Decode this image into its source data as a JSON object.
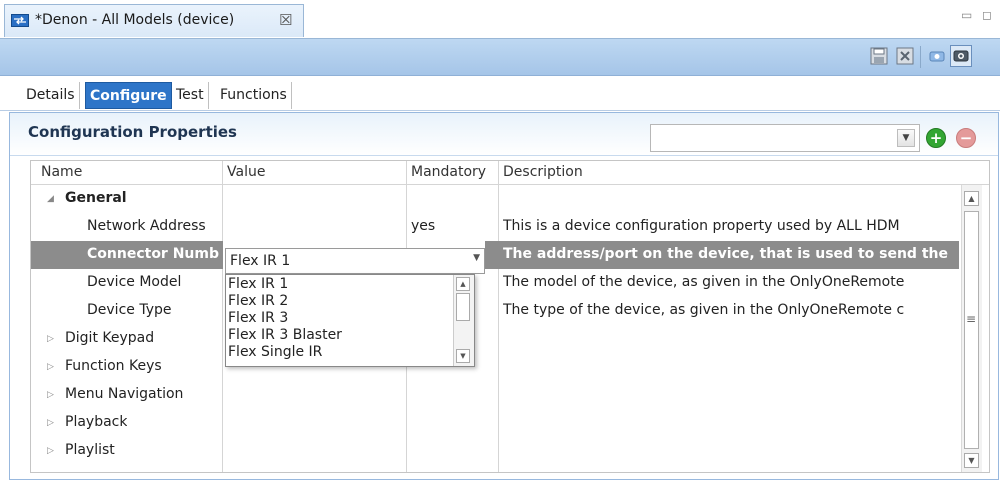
{
  "editor": {
    "tab_title": "*Denon - All Models (device)",
    "close_glyph": "☒",
    "minimize_glyph": "▭",
    "maximize_glyph": "◻"
  },
  "toolbar": {
    "icons": [
      "save-icon",
      "revert-icon",
      "device-settings-icon",
      "device-active-icon"
    ]
  },
  "subtabs": [
    "Details",
    "Configure",
    "Test",
    "Functions"
  ],
  "active_subtab": "Configure",
  "panel": {
    "title": "Configuration Properties",
    "filter_value": "",
    "add_icon": "add-icon",
    "remove_icon": "remove-icon"
  },
  "grid": {
    "columns": [
      "Name",
      "Value",
      "Mandatory",
      "Description"
    ],
    "groups": [
      {
        "name": "General",
        "expanded": true,
        "rows": [
          {
            "name": "Network Address",
            "value": "",
            "mandatory": "yes",
            "description": "This is a device configuration property used by ALL HDM"
          },
          {
            "name": "Connector Numb",
            "value": "Flex IR 1",
            "mandatory": "",
            "description": "The address/port on the device, that is used to send the",
            "selected": true
          },
          {
            "name": "Device Model",
            "value": "",
            "mandatory": "",
            "description": "The model of the device, as given in the OnlyOneRemote"
          },
          {
            "name": "Device Type",
            "value": "",
            "mandatory": "",
            "description": "The type of the device, as given in the OnlyOneRemote c"
          }
        ]
      },
      {
        "name": "Digit Keypad",
        "expanded": false
      },
      {
        "name": "Function Keys",
        "expanded": false
      },
      {
        "name": "Menu Navigation",
        "expanded": false
      },
      {
        "name": "Playback",
        "expanded": false
      },
      {
        "name": "Playlist",
        "expanded": false
      }
    ],
    "dropdown_options": [
      "Flex IR 1",
      "Flex IR 2",
      "Flex IR 3",
      "Flex IR 3 Blaster",
      "Flex Single IR"
    ],
    "scroll_middle_glyph": "≡"
  },
  "colors": {
    "accent": "#2e75c8",
    "band": "#b2cdea",
    "selection": "#8c8c8c",
    "add_green": "#33a633",
    "remove_red": "#e49a9a"
  }
}
